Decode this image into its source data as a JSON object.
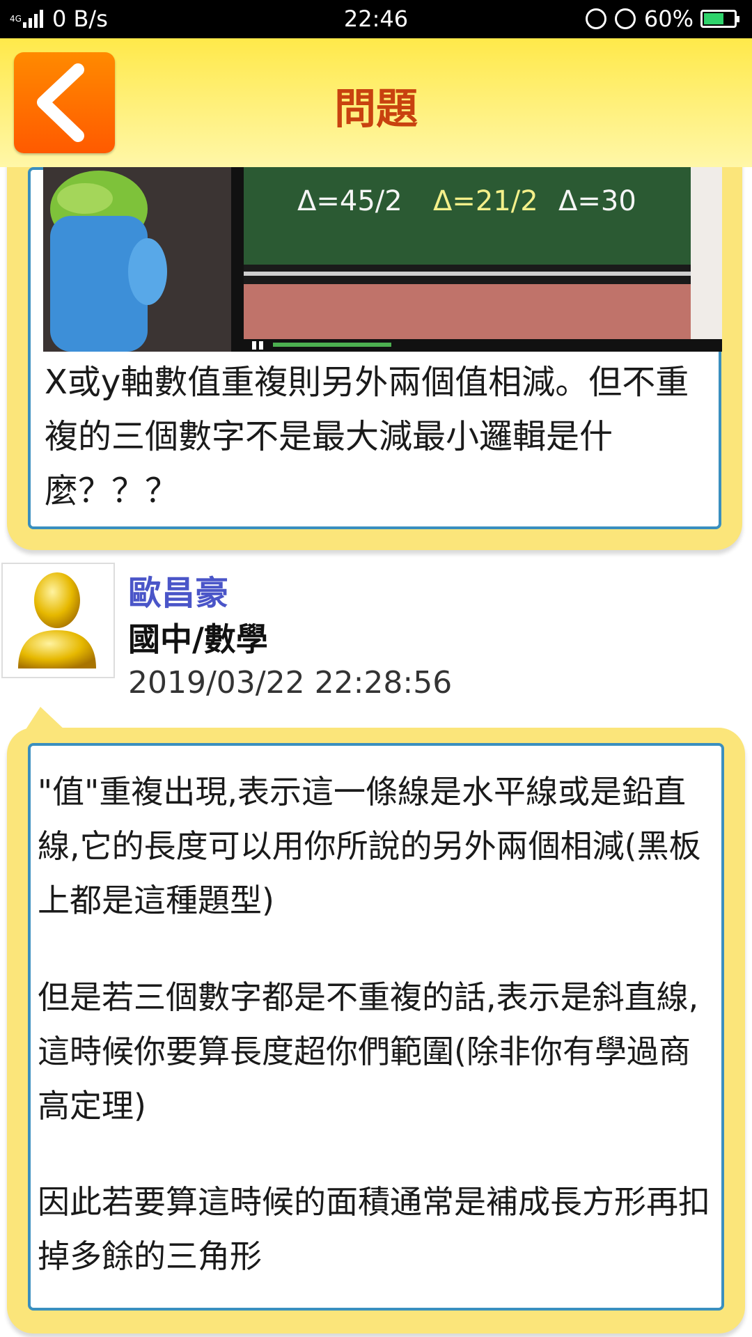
{
  "status_bar": {
    "network": "4G",
    "speed": "0 B/s",
    "time": "22:46",
    "battery": "60%"
  },
  "header": {
    "title": "問題",
    "back_icon": "chevron-left-icon",
    "accent": "#c8420f"
  },
  "question": {
    "photo_formulas": [
      "Δ=45/2",
      "Δ=21/2",
      "Δ=30"
    ],
    "text": "X或y軸數值重複則另外兩個值相減。但不重複的三個數字不是最大減最小邏輯是什麼？？？"
  },
  "answer": {
    "author_name": "歐昌豪",
    "subject": "國中/數學",
    "timestamp": "2019/03/22 22:28:56",
    "paragraphs": [
      "\"值\"重複出現,表示這一條線是水平線或是鉛直線,它的長度可以用你所說的另外兩個相減(黑板上都是這種題型)",
      "但是若三個數字都是不重複的話,表示是斜直線,這時候你要算長度超你們範圍(除非你有學過商高定理)",
      "因此若要算這時候的面積通常是補成長方形再扣掉多餘的三角形"
    ]
  },
  "colors": {
    "card_yellow": "#fbe57a",
    "card_border": "#3a8fbf",
    "author_blue": "#4a55c8"
  }
}
